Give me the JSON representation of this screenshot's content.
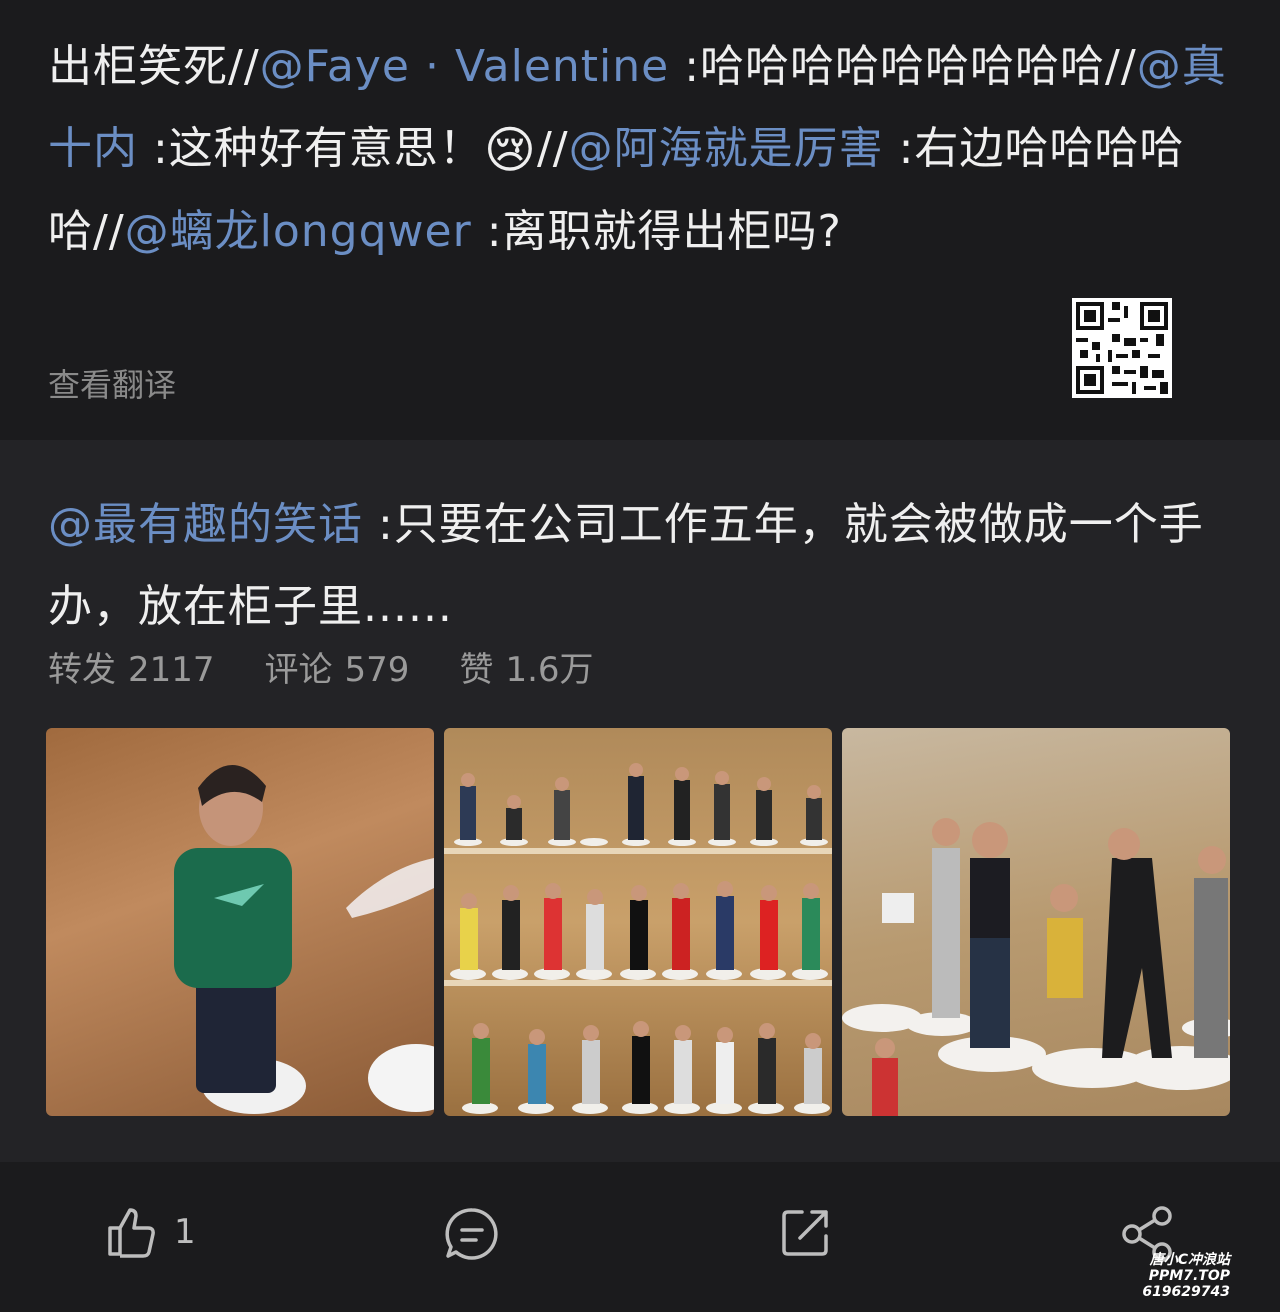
{
  "repost": {
    "segments": [
      {
        "text": "出柜笑死//",
        "type": "plain"
      },
      {
        "text": "@Faye · Valentine",
        "type": "mention"
      },
      {
        "text": " :哈哈哈哈哈哈哈哈哈//",
        "type": "plain"
      },
      {
        "text": "@真十内",
        "type": "mention"
      },
      {
        "text": " :这种好有意思！",
        "type": "plain"
      },
      {
        "text": "😢",
        "type": "emoji"
      },
      {
        "text": "//",
        "type": "plain"
      },
      {
        "text": "@阿海就是厉害",
        "type": "mention"
      },
      {
        "text": " :右边哈哈哈哈哈//",
        "type": "plain"
      },
      {
        "text": "@螭龙longqwer",
        "type": "mention"
      },
      {
        "text": " :离职就得出柜吗?",
        "type": "plain"
      }
    ],
    "translate_label": "查看翻译"
  },
  "original": {
    "mention": "@最有趣的笑话",
    "text": " :只要在公司工作五年，就会被做成一个手办，放在柜子里......",
    "stats": {
      "repost_label": "转发",
      "repost_count": "2117",
      "comment_label": "评论",
      "comment_count": "579",
      "like_label": "赞",
      "like_count": "1.6万"
    },
    "images": [
      {
        "icon": "figurine-single-photo"
      },
      {
        "icon": "figurine-shelf-photo"
      },
      {
        "icon": "figurine-group-photo"
      }
    ]
  },
  "actions": {
    "like_count": "1"
  },
  "watermark": {
    "line1": "唐小C冲浪站",
    "line2": "PPM7.TOP",
    "line3": "619629743"
  },
  "colors": {
    "mention": "#6b8ec4",
    "background": "#1b1b1d",
    "card": "#232326"
  }
}
